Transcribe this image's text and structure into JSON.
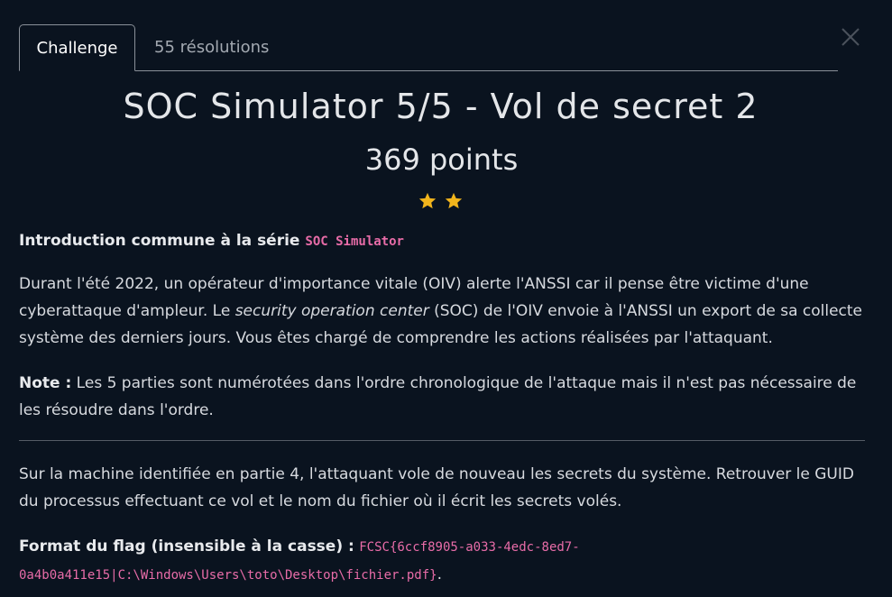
{
  "tabs": {
    "challenge": "Challenge",
    "resolutions": "55 résolutions"
  },
  "challenge": {
    "title": "SOC Simulator 5/5 - Vol de secret 2",
    "points": "369 points",
    "difficulty_stars": 2
  },
  "intro": {
    "heading": "Introduction commune à la série",
    "series_code": "SOC Simulator",
    "p1_part1": "Durant l'été 2022, un opérateur d'importance vitale (OIV) alerte l'ANSSI car il pense être victime d'une cyberattaque d'ampleur. Le ",
    "p1_italic": "security operation center",
    "p1_part2": " (SOC) de l'OIV envoie à l'ANSSI un export de sa collecte système des derniers jours. Vous êtes chargé de comprendre les actions réalisées par l'attaquant.",
    "note_label": "Note :",
    "note_text": " Les 5 parties sont numérotées dans l'ordre chronologique de l'attaque mais il n'est pas nécessaire de les résoudre dans l'ordre."
  },
  "task": {
    "text": "Sur la machine identifiée en partie 4, l'attaquant vole de nouveau les secrets du système. Retrouver le GUID du processus effectuant ce vol et le nom du fichier où il écrit les secrets volés.",
    "format_label": "Format du flag (insensible à la casse) :",
    "format_code": "FCSC{6ccf8905-a033-4edc-8ed7-0a4b0a411e15|C:\\Windows\\Users\\toto\\Desktop\\fichier.pdf}",
    "format_end": "."
  },
  "colors": {
    "background": "#0a131f",
    "code_pink": "#e86ca8",
    "star_gold": "#f2b51c"
  }
}
